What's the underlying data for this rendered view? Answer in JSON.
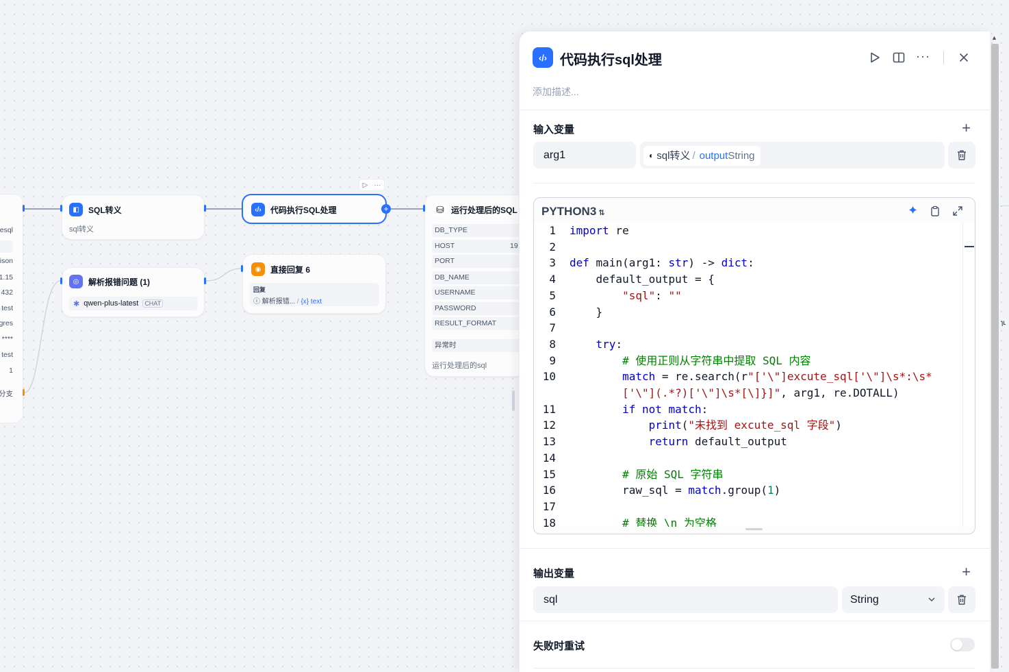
{
  "canvas": {
    "left_node": {
      "labels": [
        "esql",
        "ison",
        "1.15",
        "432",
        "test",
        "gres",
        "****",
        "test",
        "1",
        "分支"
      ]
    },
    "sql_escape_node": {
      "title": "SQL转义",
      "subtitle": "sql转义",
      "icon": "brackets-icon",
      "color": "#2970ff"
    },
    "code_node": {
      "title": "代码执行SQL处理",
      "icon": "code-icon",
      "color": "#2970ff"
    },
    "parse_error_node": {
      "title": "解析报错问题 (1)",
      "model": "qwen-plus-latest",
      "model_tag": "CHAT",
      "color": "#6172f3"
    },
    "reply_node": {
      "title": "直接回复 6",
      "label": "回复",
      "ref_source": "解析报错...",
      "ref_sep": "/",
      "ref_var": "{x} text",
      "color": "#f79009"
    },
    "db_node": {
      "title": "运行处理后的SQL",
      "params": [
        "DB_TYPE",
        "HOST",
        "PORT",
        "DB_NAME",
        "USERNAME",
        "PASSWORD",
        "RESULT_FORMAT"
      ],
      "host_value": "19",
      "error_label": "异常时",
      "footer": "运行处理后的sql"
    }
  },
  "panel": {
    "title": "代码执行sql处理",
    "description_placeholder": "添加描述...",
    "input_section": {
      "title": "输入变量",
      "variable_name": "arg1",
      "source_node": "sql转义",
      "source_sep": "/",
      "source_var": "output",
      "source_type": "String"
    },
    "editor": {
      "language": "PYTHON3",
      "lines": [
        {
          "n": "1",
          "html": "<span class='kw'>import</span> re"
        },
        {
          "n": "2",
          "html": ""
        },
        {
          "n": "3",
          "html": "<span class='kw'>def</span> main(arg1: <span class='kw'>str</span>) -> <span class='kw'>dict</span>:"
        },
        {
          "n": "4",
          "html": "    default_output = {"
        },
        {
          "n": "5",
          "html": "        <span class='st'>\"sql\"</span>: <span class='st'>\"\"</span>"
        },
        {
          "n": "6",
          "html": "    }"
        },
        {
          "n": "7",
          "html": ""
        },
        {
          "n": "8",
          "html": "    <span class='kw'>try</span>:"
        },
        {
          "n": "9",
          "html": "        <span class='cm'># 使用正则从字符串中提取 SQL 内容</span>"
        },
        {
          "n": "10",
          "html": "        <span class='kw'>match</span> = re.search(r<span class='st'>\"['\\\"]excute_sql['\\\"]\\s*:\\s*</span>"
        },
        {
          "n": "",
          "html": "        <span class='st'>['\\\"](.*?)['\\\"]\\s*[\\]}]\"</span>, arg1, re.DOTALL)"
        },
        {
          "n": "11",
          "html": "        <span class='kw'>if not</span> <span class='kw'>match</span>:"
        },
        {
          "n": "12",
          "html": "            <span class='kw'>print</span>(<span class='st'>\"未找到 excute_sql 字段\"</span>)"
        },
        {
          "n": "13",
          "html": "            <span class='kw'>return</span> default_output"
        },
        {
          "n": "14",
          "html": ""
        },
        {
          "n": "15",
          "html": "        <span class='cm'># 原始 SQL 字符串</span>"
        },
        {
          "n": "16",
          "html": "        raw_sql = <span class='kw'>match</span>.group(<span class='nm'>1</span>)"
        },
        {
          "n": "17",
          "html": ""
        },
        {
          "n": "18",
          "html": "        <span class='cm'># 替换 \\n 为空格</span>"
        }
      ]
    },
    "output_section": {
      "title": "输出变量",
      "variable_name": "sql",
      "type": "String"
    },
    "retry": {
      "label": "失败时重试",
      "enabled": false
    }
  },
  "colors": {
    "accent": "#2970ff",
    "panel_bg": "#ffffff",
    "canvas_bg": "#f2f4f7"
  }
}
